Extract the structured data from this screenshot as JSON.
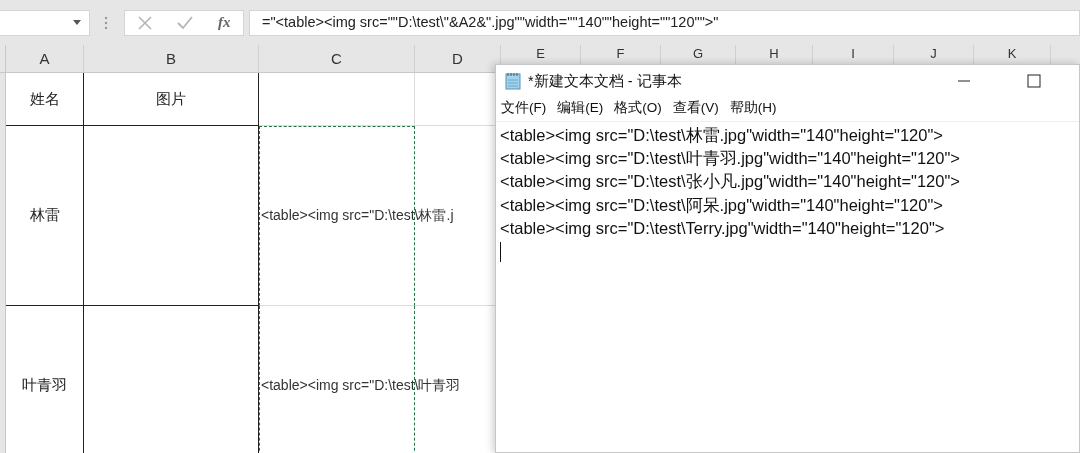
{
  "formula_bar": {
    "function_label": "fx",
    "formula": "=\"<table><img src=\"\"D:\\test\\\"&A2&\".jpg\"\"width=\"\"140\"\"height=\"\"120\"\">\""
  },
  "columns": [
    "A",
    "B",
    "C",
    "D",
    "E",
    "F",
    "G",
    "H",
    "I",
    "J",
    "K"
  ],
  "rows": [
    {
      "column_a": "姓名",
      "column_b": "图片"
    },
    {
      "column_a": "林雷",
      "column_c": "<table><img src=\"D:\\test\\林雷.j"
    },
    {
      "column_a": "叶青羽",
      "column_c": "<table><img src=\"D:\\test\\叶青羽"
    }
  ],
  "notepad": {
    "title": "*新建文本文档 - 记事本",
    "menu": [
      "文件(F)",
      "编辑(E)",
      "格式(O)",
      "查看(V)",
      "帮助(H)"
    ],
    "lines": [
      "<table><img src=\"D:\\test\\林雷.jpg\"width=\"140\"height=\"120\">",
      "<table><img src=\"D:\\test\\叶青羽.jpg\"width=\"140\"height=\"120\">",
      "<table><img src=\"D:\\test\\张小凡.jpg\"width=\"140\"height=\"120\">",
      "<table><img src=\"D:\\test\\阿呆.jpg\"width=\"140\"height=\"120\">",
      "<table><img src=\"D:\\test\\Terry.jpg\"width=\"140\"height=\"120\">"
    ]
  }
}
